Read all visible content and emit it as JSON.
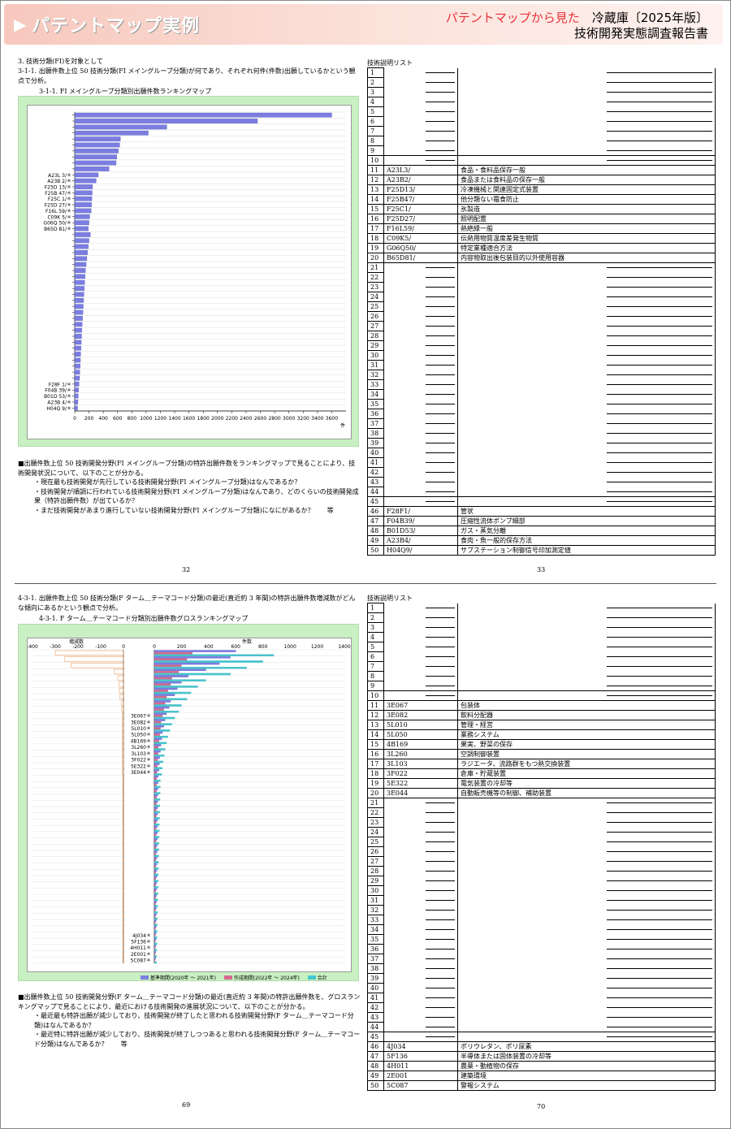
{
  "header": {
    "arrow": "▶",
    "title": "パテントマップ実例",
    "subtitle_red": "パテントマップから見た",
    "subtitle_black": "冷蔵庫〔2025年版〕",
    "report": "技術開発実態調査報告書"
  },
  "top": {
    "section": "3. 技術分類(FI)を対象として",
    "heading1": "3-1-1. 出願件数上位 50 技術分類(FI メイングループ分類)が何であり、それぞれ何件(件数)出願しているかという観点で分析。",
    "chart_title": "3-1-1. FI メイングループ分類別出願件数ランキングマップ",
    "chart_ylabels_top": [
      "A23L 3/＊",
      "A23B 2/＊",
      "F25D 13/＊",
      "F25B 47/＊",
      "F25C 1/＊",
      "F25D 27/＊",
      "F16L 59/＊",
      "C09K 5/＊",
      "G06Q 50/＊",
      "B65D 81/＊"
    ],
    "chart_ylabels_bottom": [
      "F28F 1/＊",
      "F04B 39/＊",
      "B01D 53/＊",
      "A23B 4/＊",
      "H04Q 9/＊"
    ],
    "axis_unit": "件",
    "para": [
      "■出願件数上位 50 技術開発分野(FI メイングループ分類)の特許出願件数をランキングマップで見ることにより、技術開発状況について、以下のことが分かる。",
      "・現在最も技術開発が先行している技術開発分野(FI メイングループ分類)はなんであるか？",
      "・技術開発が順調に行われている技術開発分野(FI メイングループ分類)はなんであり、どのくらいの技術開発成果（特許出願件数）が出ているか？",
      "・まだ技術開発があまり進行していない技術開発分野(FI メイングループ分類)になにがあるか？　　等"
    ],
    "page_left": "32",
    "page_right": "33",
    "list_title": "技術説明リスト",
    "rows_mid": [
      [
        "A23L3/",
        "食品・食料品保存一般"
      ],
      [
        "A23B2/",
        "食品または食料品の保存一般"
      ],
      [
        "F25D13/",
        "冷凍機械と関連固定式装置"
      ],
      [
        "F25B47/",
        "他分類ない霜食防止"
      ],
      [
        "F25C1/",
        "氷製造"
      ],
      [
        "F25D27/",
        "照明配置"
      ],
      [
        "F16L59/",
        "熱絶縁一般"
      ],
      [
        "C09K5/",
        "伝熱用物質温度差発生物質"
      ],
      [
        "G06Q50/",
        "特定業種適合方法"
      ],
      [
        "B65D81/",
        "内容物取出後包装目的以外使用容器"
      ]
    ],
    "rows_end": [
      [
        "F28F1/",
        "管状"
      ],
      [
        "F04B39/",
        "圧縮性流体ポンプ細部"
      ],
      [
        "B01D53/",
        "ガス・蒸気分離"
      ],
      [
        "A23B4/",
        "食肉・魚一般的保存方法"
      ],
      [
        "H04Q9/",
        "サブステーション制御信号印加測定値"
      ]
    ]
  },
  "bottom": {
    "heading1": "4-3-1. 出願件数上位 50 技術分類(F ターム＿テーマコード分類)の最近(直近約 3 年間)の特許出願件数増減数がどんな傾向にあるかという観点で分析。",
    "chart_title": "4-3-1. F ターム＿テーマコード分類別出願件数グロスランキングマップ",
    "left_axis_label": "増減数",
    "right_axis_label": "件数",
    "left_ticks": [
      "-400",
      "-300",
      "-200",
      "-100",
      "0"
    ],
    "right_ticks": [
      "0",
      "200",
      "400",
      "600",
      "800",
      "1000",
      "1200",
      "1400"
    ],
    "ylabels_top": [
      "3E067＊",
      "3E082＊",
      "5L010＊",
      "5L050＊",
      "4B169＊",
      "3L260＊",
      "3L103＊",
      "3F022＊",
      "5E322＊",
      "3E044＊"
    ],
    "ylabels_bottom": [
      "4J034＊",
      "5F136＊",
      "4H011＊",
      "2E001＊",
      "5C087＊"
    ],
    "legend": [
      "基準期間(2020年 ～ 2021年)",
      "作成期間(2022年 ～ 2024年)",
      "合計"
    ],
    "para": [
      "■出願件数上位 50 技術開発分野(F ターム＿テーマコード分類)の最近(直近約 3 年間)の特許出願件数を、グロスランキングマップで見ることにより、最近における技術開発の進展状況について、以下のことが分かる。",
      "・最近最も特許出願が減少しており、技術開発が終了したと思われる技術開発分野(F ターム＿テーマコード分類)はなんであるか？",
      "・最近特に特許出願が減少しており、技術開発が終了しつつあると思われる技術開発分野(F ターム＿テーマコード分類)はなんであるか？　　等"
    ],
    "page_left": "69",
    "page_right": "70",
    "list_title": "技術説明リスト",
    "rows_mid": [
      [
        "3E067",
        "包装体"
      ],
      [
        "3E082",
        "飲料分配器"
      ],
      [
        "5L010",
        "管理・経営"
      ],
      [
        "5L050",
        "業務システム"
      ],
      [
        "4B169",
        "果実、野菜の保存"
      ],
      [
        "3L260",
        "空調制御装置"
      ],
      [
        "3L103",
        "ラジエータ、流路群をもつ熱交換装置"
      ],
      [
        "3F022",
        "倉庫・貯蔵装置"
      ],
      [
        "5E322",
        "電気装置の冷却等"
      ],
      [
        "3E044",
        "自動販売機等の制御、補助装置"
      ]
    ],
    "rows_end": [
      [
        "4J034",
        "ポリウレタン、ポリ尿素"
      ],
      [
        "5F136",
        "半導体または固体装置の冷却等"
      ],
      [
        "4H011",
        "農薬・動植物の保存"
      ],
      [
        "2E001",
        "建築環境"
      ],
      [
        "5C087",
        "警報システム"
      ]
    ]
  },
  "chart_data": [
    {
      "type": "bar",
      "title": "3-1-1. FI メイングループ分類別出願件数ランキングマップ",
      "xlabel": "件",
      "xlim": [
        0,
        3800
      ],
      "xticks": [
        0,
        200,
        400,
        600,
        800,
        1000,
        1200,
        1400,
        1600,
        1800,
        2000,
        2200,
        2400,
        2600,
        2800,
        3000,
        3200,
        3400,
        3600
      ],
      "categories": [
        "A23L 3/＊",
        "A23B 2/＊",
        "F25D 13/＊",
        "F25B 47/＊",
        "F25C 1/＊",
        "F25D 27/＊",
        "F16L 59/＊",
        "C09K 5/＊",
        "G06Q 50/＊",
        "B65D 81/＊",
        "F28F 1/＊",
        "F04B 39/＊",
        "B01D 53/＊",
        "A23B 4/＊",
        "H04Q 9/＊"
      ],
      "values": [
        3600,
        2560,
        1290,
        1030,
        640,
        630,
        610,
        590,
        580,
        480,
        60,
        55,
        50,
        45,
        40
      ]
    },
    {
      "type": "bar",
      "title": "4-3-1. F ターム＿テーマコード分類別出願件数グロスランキングマップ",
      "xlabel": "件数",
      "xlim": [
        0,
        1400
      ],
      "series": [
        {
          "name": "基準期間(2020年 ～ 2021年)",
          "values": [
            600,
            560,
            480,
            380,
            250,
            200,
            170,
            150,
            120,
            110
          ]
        },
        {
          "name": "作成期間(2022年 ～ 2024年)",
          "values": [
            280,
            240,
            200,
            180,
            130,
            120,
            100,
            90,
            80,
            70
          ]
        },
        {
          "name": "合計",
          "values": [
            880,
            800,
            680,
            560,
            380,
            320,
            270,
            240,
            200,
            180
          ]
        }
      ]
    }
  ],
  "colors": {
    "bar": "#7b7ee0",
    "bar2": "#d46a8e",
    "bar3": "#46c6cf",
    "neg": "#f0a060",
    "chartbg": "#c9f0c2"
  }
}
